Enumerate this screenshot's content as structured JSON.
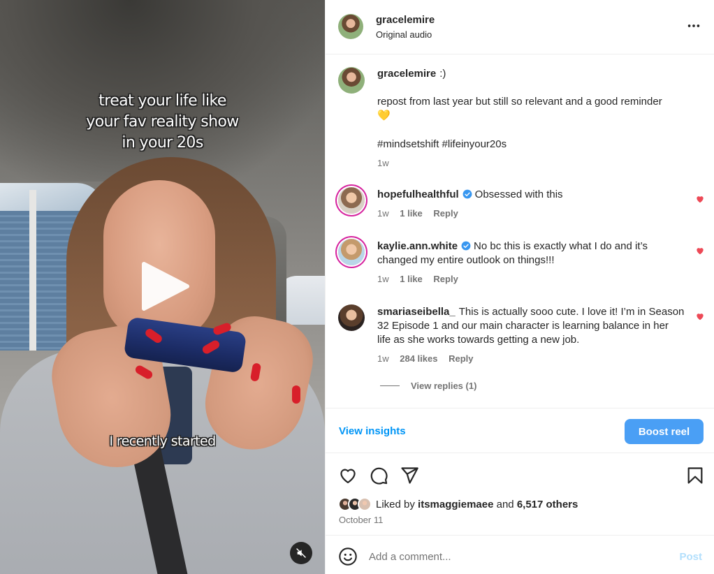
{
  "video": {
    "caption_top": "treat your life like\nyour fav reality show\nin your 20s",
    "caption_bottom": "I recently started",
    "play_icon": "play-icon",
    "mute_icon": "volume-muted-icon"
  },
  "header": {
    "username": "gracelemire",
    "audio": "Original audio",
    "more_icon": "more-horizontal-icon"
  },
  "caption": {
    "username": "gracelemire",
    "text": ":)",
    "body": "repost from last year but still so relevant and a good reminder",
    "emoji": "💛",
    "hashtags": "#mindsetshift #lifeinyour20s",
    "time": "1w"
  },
  "comments": [
    {
      "username": "hopefulhealthful",
      "verified": true,
      "text": "Obsessed with this",
      "time": "1w",
      "likes": "1 like",
      "reply": "Reply"
    },
    {
      "username": "kaylie.ann.white",
      "verified": true,
      "text": "No bc this is exactly what I do and it’s changed my entire outlook on things!!!",
      "time": "1w",
      "likes": "1 like",
      "reply": "Reply"
    },
    {
      "username": "smariaseibella_",
      "verified": false,
      "text": "This is actually sooo cute. I love it! I’m in Season 32 Episode 1 and our main character is learning balance in her life as she works towards getting a new job.",
      "time": "1w",
      "likes": "284 likes",
      "reply": "Reply",
      "view_replies": "View replies (1)"
    }
  ],
  "insights": {
    "view_insights": "View insights",
    "boost": "Boost reel"
  },
  "actions": {
    "icons": [
      "heart-icon",
      "comment-icon",
      "share-icon",
      "bookmark-icon"
    ],
    "liked_prefix": "Liked by",
    "liked_user": "itsmaggiemaee",
    "liked_and": "and",
    "liked_others": "6,517 others",
    "date": "October 11"
  },
  "add_comment": {
    "placeholder": "Add a comment...",
    "post": "Post"
  },
  "colors": {
    "accent": "#0095f6",
    "boost_bg": "#4a9ff5",
    "heart_red": "#ed4956",
    "verified_blue": "#3897f0",
    "post_disabled": "#b2dffc"
  }
}
